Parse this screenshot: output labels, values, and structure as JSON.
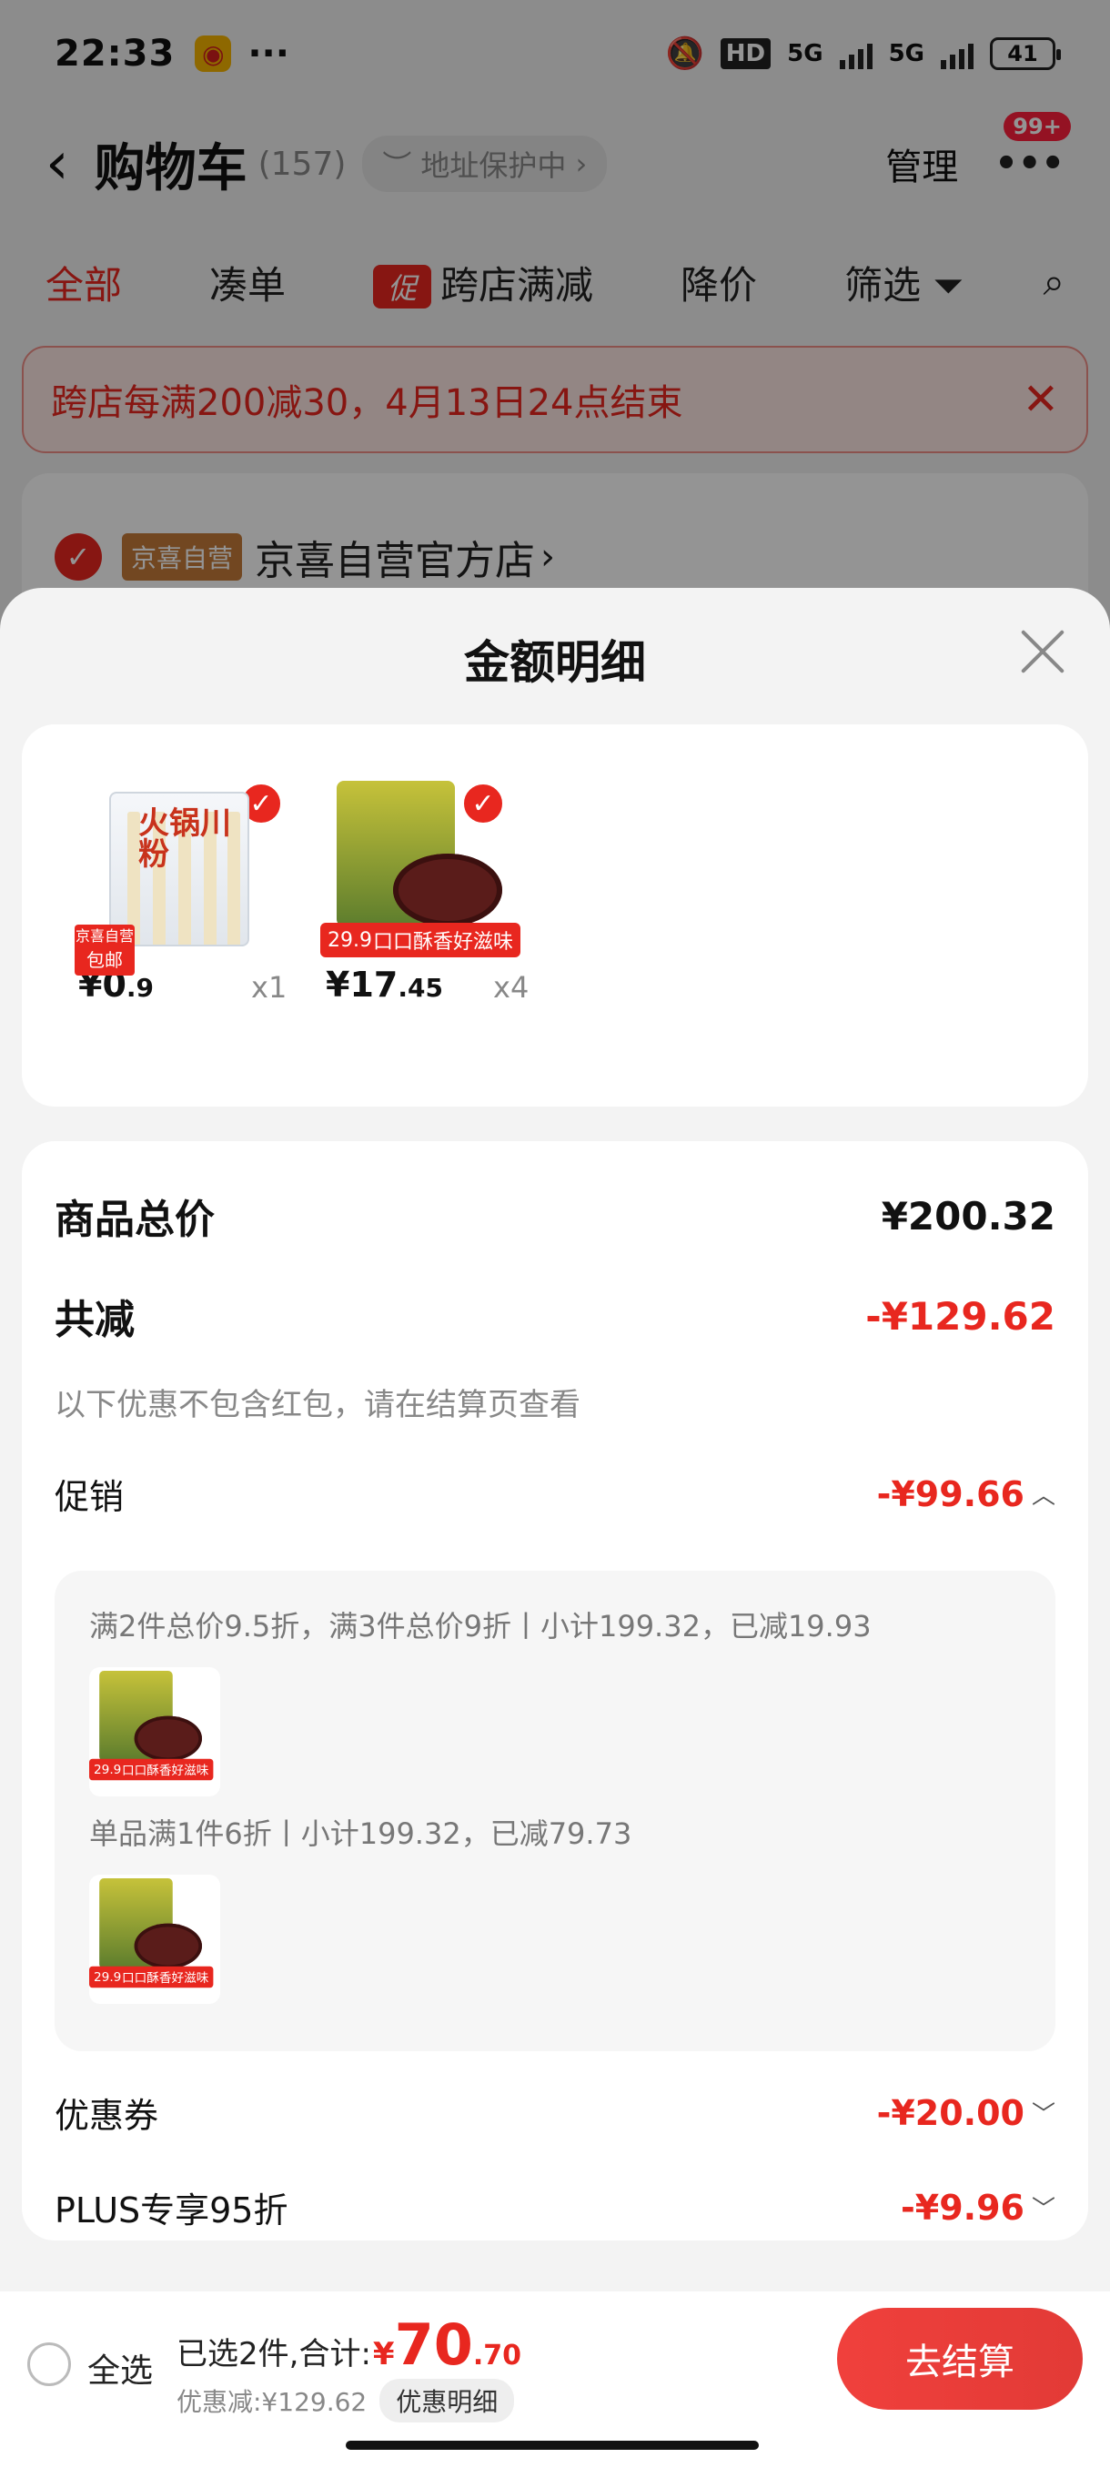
{
  "status_bar": {
    "time": "22:33",
    "network_a": "5G",
    "network_b": "5G",
    "hd": "HD",
    "battery": "41"
  },
  "nav": {
    "title": "购物车",
    "count": "(157)",
    "address_pill": "地址保护中",
    "manage": "管理",
    "badge": "99+"
  },
  "filters": {
    "all": "全部",
    "combine": "凑单",
    "promo_tag": "促",
    "cross_store": "跨店满减",
    "price_drop": "降价",
    "filter": "筛选"
  },
  "banner": {
    "text": "跨店每满200减30，4月13日24点结束"
  },
  "store": {
    "tag": "京喜自营",
    "name": "京喜自营官方店"
  },
  "sheet": {
    "title": "金额明细",
    "items": [
      {
        "price_int": "¥0",
        "price_dec": ".9",
        "qty": "x1",
        "pkg_text": "火锅川粉",
        "tag_top": "京喜自营",
        "tag_bottom": "包邮"
      },
      {
        "price_int": "¥17",
        "price_dec": ".45",
        "qty": "x4",
        "pkg_price": "29.9",
        "pkg_slogan": "口口酥香好滋味"
      }
    ],
    "total": {
      "label": "商品总价",
      "value": "¥200.32"
    },
    "reduce": {
      "label": "共减",
      "value": "-¥129.62",
      "hint": "以下优惠不包含红包，请在结算页查看"
    },
    "promotion": {
      "label": "促销",
      "value": "-¥99.66",
      "rule1": "满2件总价9.5折，满3件总价9折丨小计199.32，已减19.93",
      "rule2": "单品满1件6折丨小计199.32，已减79.73"
    },
    "coupon": {
      "label": "优惠券",
      "value": "-¥20.00"
    },
    "plus": {
      "label": "PLUS专享95折",
      "value": "-¥9.96"
    }
  },
  "footer": {
    "select_all": "全选",
    "selected_text": "已选2件,合计:",
    "currency": "¥",
    "total_int": "70",
    "total_dec": ".70",
    "discount": "优惠减:¥129.62",
    "detail_button": "优惠明细",
    "checkout": "去结算"
  },
  "colors": {
    "accent": "#e8271f",
    "checkout": "#f0403c"
  }
}
